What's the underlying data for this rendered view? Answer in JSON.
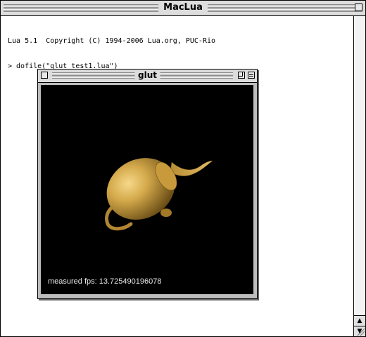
{
  "main_window": {
    "title": "MacLua",
    "console_lines": [
      "Lua 5.1  Copyright (C) 1994-2006 Lua.org, PUC-Rio",
      "> dofile(\"glut_test1.lua\")"
    ]
  },
  "glut_window": {
    "title": "glut",
    "fps_text": "measured fps: 13.725490196078"
  },
  "colors": {
    "teapot": "#c9a043",
    "canvas": "#000000"
  }
}
